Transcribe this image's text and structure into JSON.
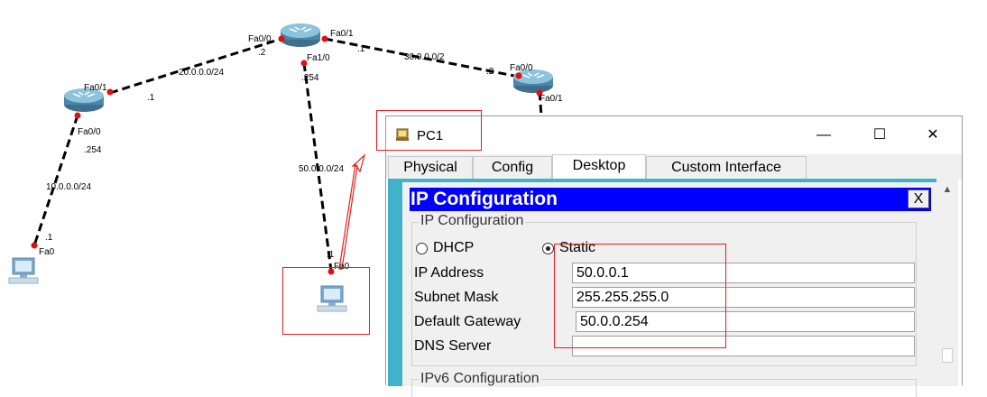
{
  "topology": {
    "links": [
      {
        "network": "20.0.0.0/24"
      },
      {
        "network": "30.0.0.0/2"
      },
      {
        "network": "10.0.0.0/24"
      },
      {
        "network": "50.0.0.0/24"
      }
    ],
    "labels": {
      "r_left_fa01": "Fa0/1",
      "r_left_fa00": "Fa0/0",
      "r_left_dot1": ".1",
      "r_left_dot254": ".254",
      "r_top_fa00": "Fa0/0",
      "r_top_fa01": "Fa0/1",
      "r_top_fa10": "Fa1/0",
      "r_top_dot2": ".2",
      "r_top_dot1": ".1",
      "r_top_dot254": ".254",
      "r_right_fa00": "Fa0/0",
      "r_right_fa01": "Fa0/1",
      "r_right_dot2": ".2",
      "pc_left_fa0": "Fa0",
      "pc_left_dot1": ".1",
      "pc_mid_fa0": "Fa0",
      "pc_mid_dot1": ".1"
    }
  },
  "window": {
    "title": "PC1",
    "minimize": "—",
    "maximize": "☐",
    "close": "✕",
    "tabs": [
      {
        "label": "Physical"
      },
      {
        "label": "Config"
      },
      {
        "label": "Desktop"
      },
      {
        "label": "Custom Interface"
      }
    ],
    "active_tab": "Desktop"
  },
  "ipconfig": {
    "title": "IP Configuration",
    "close": "X",
    "group_caption": "IP Configuration",
    "mode_dhcp": "DHCP",
    "mode_static": "Static",
    "selected_mode": "Static",
    "fields": {
      "ip_label": "IP Address",
      "ip_value": "50.0.0.1",
      "mask_label": "Subnet Mask",
      "mask_value": "255.255.255.0",
      "gateway_label": "Default Gateway",
      "gateway_value": "50.0.0.254",
      "dns_label": "DNS Server",
      "dns_value": ""
    },
    "ipv6_caption": "IPv6 Configuration"
  },
  "colors": {
    "link": "#000000",
    "port_dot": "#e01010",
    "annotation": "#e02020",
    "ip_bar": "#0000ff",
    "panel_border": "#40b3c8"
  }
}
